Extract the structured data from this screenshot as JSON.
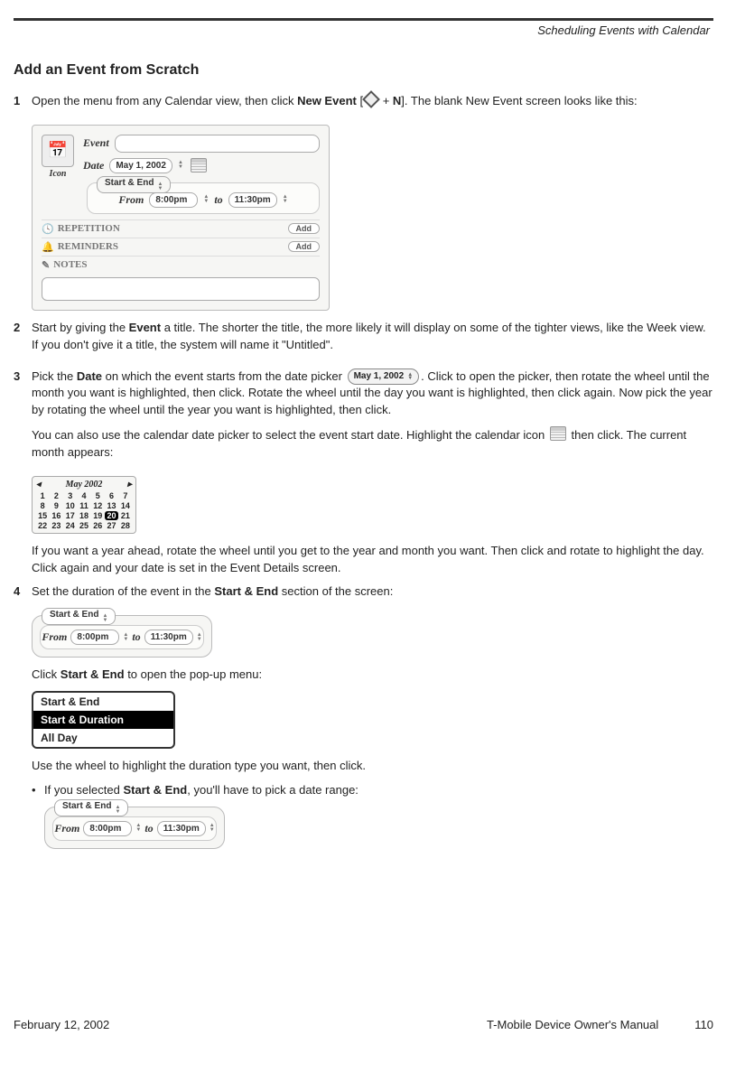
{
  "running_head": "Scheduling Events with Calendar",
  "heading": "Add an Event from Scratch",
  "step1": {
    "num": "1",
    "text_a": "Open the menu from any Calendar view, then click ",
    "bold1": "New Event",
    "text_b": " [",
    "text_c": " + ",
    "bold2": "N",
    "text_d": "]. The blank New Event screen looks like this:"
  },
  "panel_main": {
    "icon_label": "Icon",
    "event_lbl": "Event",
    "date_lbl": "Date",
    "date_val": "May 1, 2002",
    "se_title": "Start & End",
    "from_lbl": "From",
    "time1": "8:00pm",
    "to_lbl": "to",
    "time2": "11:30pm",
    "repetition_lbl": "REPETITION",
    "reminders_lbl": "REMINDERS",
    "notes_lbl": "NOTES",
    "add_lbl": "Add"
  },
  "step2": {
    "num": "2",
    "text_a": "Start by giving the ",
    "bold1": "Event",
    "text_b": " a title. The shorter the title, the more likely it will display on some of the tighter views, like the Week view. If you don't give it a title, the system will name it \"Untitled\"."
  },
  "step3": {
    "num": "3",
    "text_a": "Pick the ",
    "bold1": "Date",
    "text_b": " on which the event starts from the date picker ",
    "picker_val": "May 1, 2002",
    "text_c": ". Click to open the picker, then rotate the wheel until the month you want is highlighted, then click. Rotate the wheel until the day you want is highlighted, then click again. Now pick the year by rotating the wheel until the year you want is highlighted, then click.",
    "para2_a": "You can also use the calendar date picker to select the event start date. Highlight the calendar icon ",
    "para2_b": " then click. The current month appears:"
  },
  "mini_cal": {
    "month": "May 2002",
    "prev": "◂",
    "next": "▸",
    "days": [
      "1",
      "2",
      "3",
      "4",
      "5",
      "6",
      "7",
      "8",
      "9",
      "10",
      "11",
      "12",
      "13",
      "14",
      "15",
      "16",
      "17",
      "18",
      "19",
      "20",
      "21",
      "22",
      "23",
      "24",
      "25",
      "26",
      "27",
      "28"
    ]
  },
  "after_mini": "If you want a year ahead, rotate the wheel until you get to the year and month you want. Then click and rotate to highlight the day. Click again and your date is set in the Event Details screen.",
  "step4": {
    "num": "4",
    "text_a": "Set the duration of the event in the ",
    "bold1": "Start & End",
    "text_b": " section of the screen:"
  },
  "se_panel": {
    "title": "Start & End",
    "from": "From",
    "t1": "8:00pm",
    "to": "to",
    "t2": "11:30pm"
  },
  "click_se_a": "Click ",
  "click_se_bold": "Start & End",
  "click_se_b": " to open the pop-up menu:",
  "menu": {
    "opt1": "Start & End",
    "opt2": "Start & Duration",
    "opt3": "All Day"
  },
  "use_wheel": "Use the wheel to highlight the duration type you want, then click.",
  "bullet_a": "If you selected ",
  "bullet_bold": "Start & End",
  "bullet_b": ", you'll have to pick a date range:",
  "footer": {
    "date": "February 12, 2002",
    "manual": "T-Mobile Device Owner's Manual",
    "page": "110"
  }
}
